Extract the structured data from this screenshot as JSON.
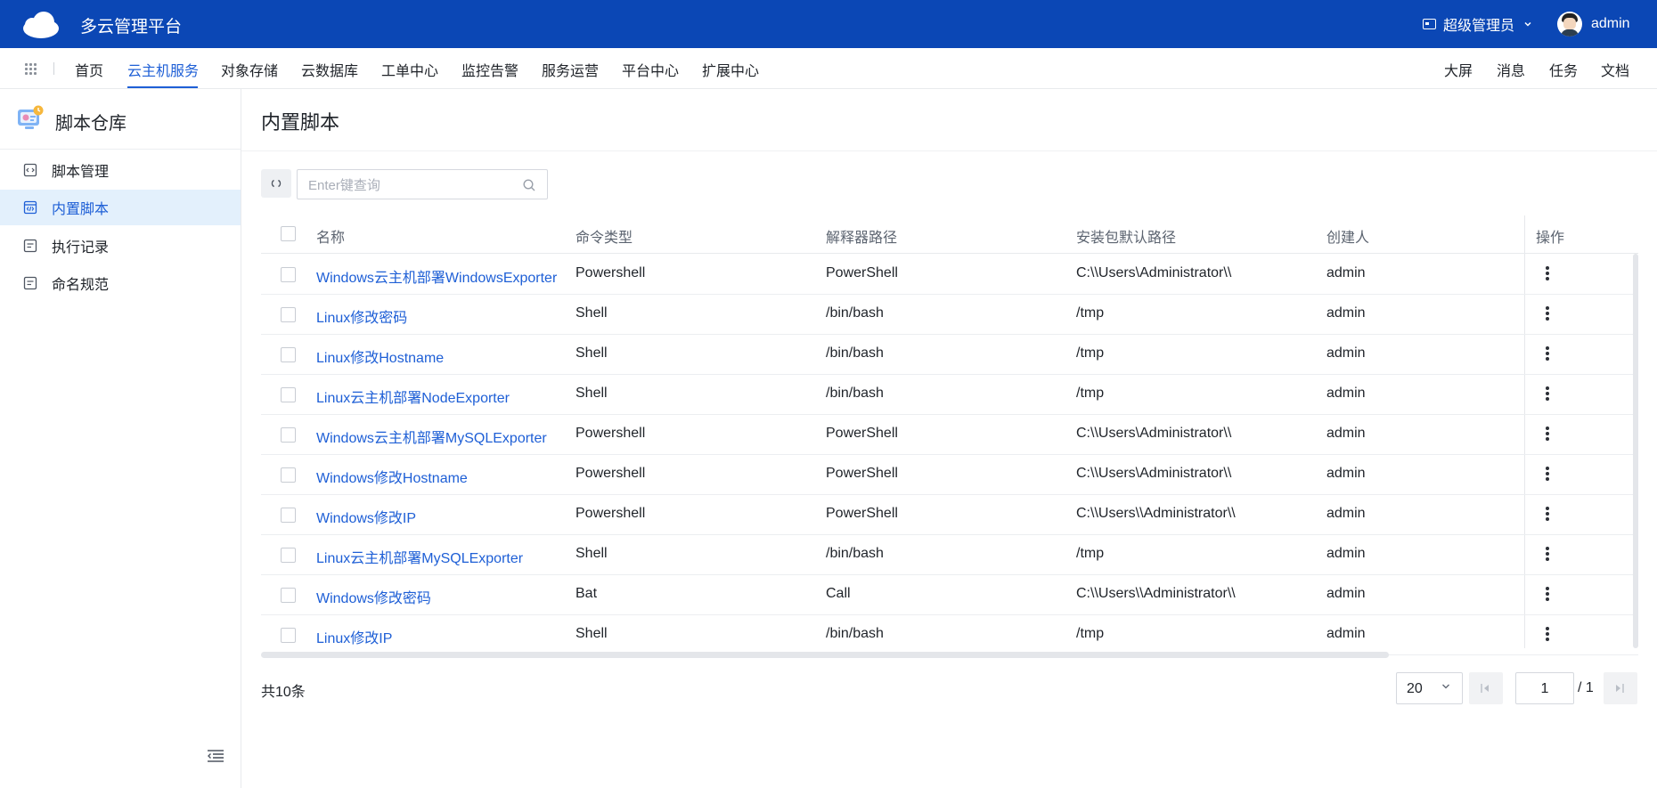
{
  "header": {
    "title": "多云管理平台",
    "role": "超级管理员",
    "username": "admin"
  },
  "nav": {
    "items": [
      "首页",
      "云主机服务",
      "对象存储",
      "云数据库",
      "工单中心",
      "监控告警",
      "服务运营",
      "平台中心",
      "扩展中心"
    ],
    "active": "云主机服务",
    "right_items": [
      "大屏",
      "消息",
      "任务",
      "文档"
    ]
  },
  "sidebar": {
    "title": "脚本仓库",
    "items": [
      {
        "label": "脚本管理",
        "icon": "code-file-icon"
      },
      {
        "label": "内置脚本",
        "icon": "code-window-icon"
      },
      {
        "label": "执行记录",
        "icon": "document-icon"
      },
      {
        "label": "命名规范",
        "icon": "document-icon"
      }
    ],
    "active": "内置脚本"
  },
  "main": {
    "title": "内置脚本",
    "search_placeholder": "Enter键查询"
  },
  "table": {
    "columns": [
      "名称",
      "命令类型",
      "解释器路径",
      "安装包默认路径",
      "创建人",
      "操作"
    ],
    "rows": [
      [
        "Windows云主机部署WindowsExporter",
        "Powershell",
        "PowerShell",
        "C:\\\\Users\\Administrator\\\\",
        "admin"
      ],
      [
        "Linux修改密码",
        "Shell",
        "/bin/bash",
        "/tmp",
        "admin"
      ],
      [
        "Linux修改Hostname",
        "Shell",
        "/bin/bash",
        "/tmp",
        "admin"
      ],
      [
        "Linux云主机部署NodeExporter",
        "Shell",
        "/bin/bash",
        "/tmp",
        "admin"
      ],
      [
        "Windows云主机部署MySQLExporter",
        "Powershell",
        "PowerShell",
        "C:\\\\Users\\Administrator\\\\",
        "admin"
      ],
      [
        "Windows修改Hostname",
        "Powershell",
        "PowerShell",
        "C:\\\\Users\\Administrator\\\\",
        "admin"
      ],
      [
        "Windows修改IP",
        "Powershell",
        "PowerShell",
        "C:\\\\Users\\\\Administrator\\\\",
        "admin"
      ],
      [
        "Linux云主机部署MySQLExporter",
        "Shell",
        "/bin/bash",
        "/tmp",
        "admin"
      ],
      [
        "Windows修改密码",
        "Bat",
        "Call",
        "C:\\\\Users\\\\Administrator\\\\",
        "admin"
      ],
      [
        "Linux修改IP",
        "Shell",
        "/bin/bash",
        "/tmp",
        "admin"
      ]
    ]
  },
  "pagination": {
    "total": "共10条",
    "page_size": "20",
    "current_page": "1",
    "total_pages": "/ 1"
  },
  "colors": {
    "header_bg": "#0b47b5",
    "accent": "#1e5fd6",
    "active_bg": "#e3f0fc"
  }
}
